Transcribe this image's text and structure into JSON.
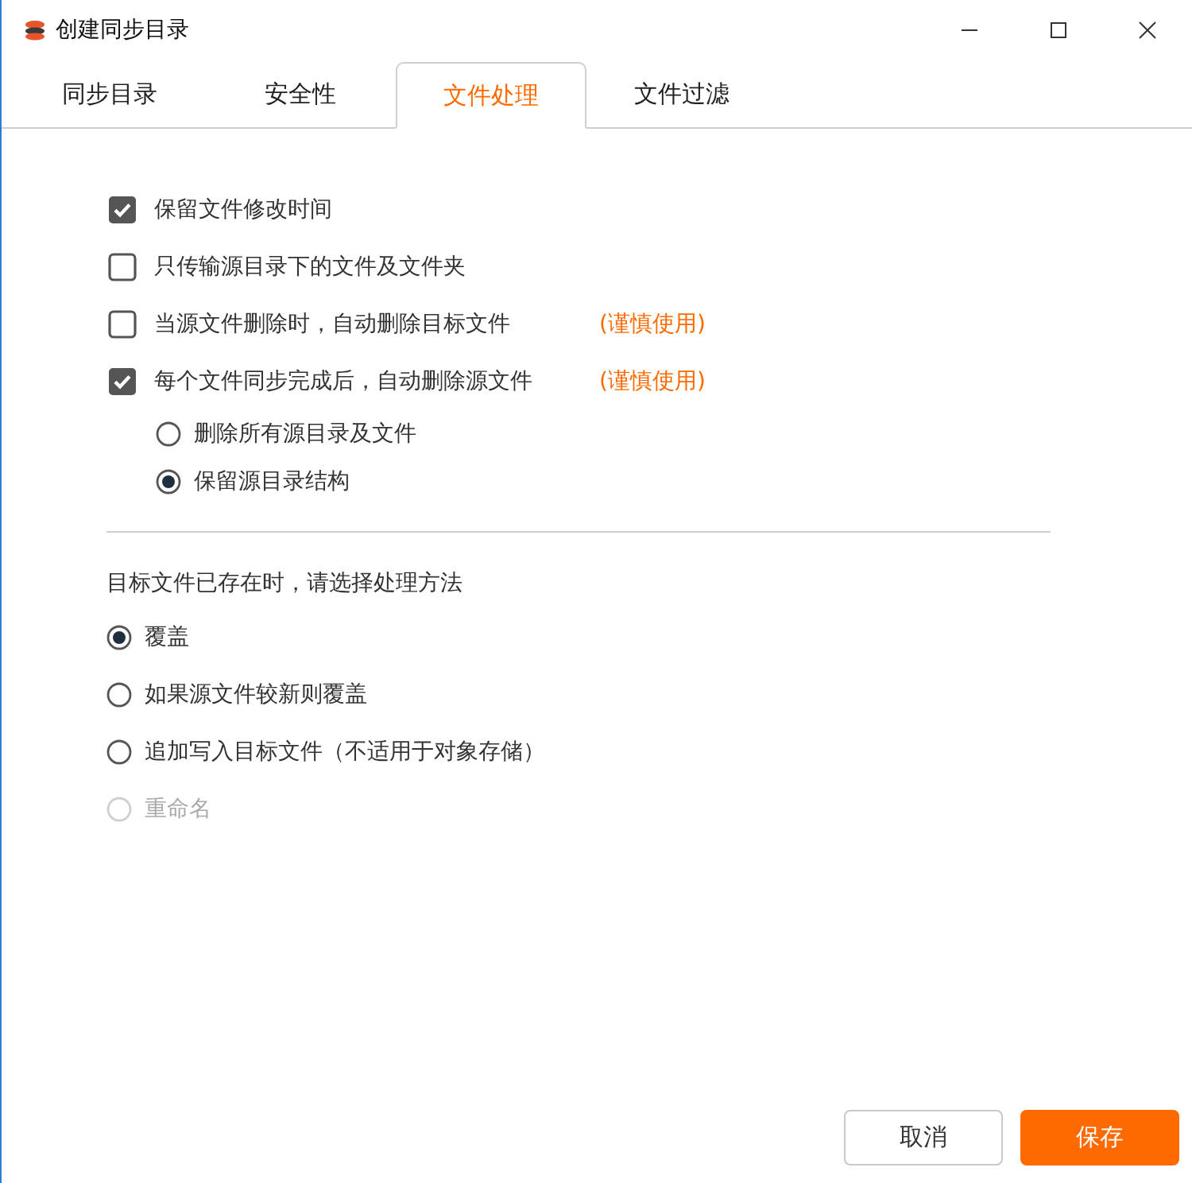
{
  "window": {
    "title": "创建同步目录"
  },
  "tabs": [
    {
      "label": "同步目录",
      "selected": false
    },
    {
      "label": "安全性",
      "selected": false
    },
    {
      "label": "文件处理",
      "selected": true
    },
    {
      "label": "文件过滤",
      "selected": false
    }
  ],
  "options": [
    {
      "label": "保留文件修改时间",
      "checked": true
    },
    {
      "label": "只传输源目录下的文件及文件夹",
      "checked": false
    },
    {
      "label": "当源文件删除时，自动删除目标文件",
      "checked": false,
      "note": "(谨慎使用)"
    },
    {
      "label": "每个文件同步完成后，自动删除源文件",
      "checked": true,
      "note": "(谨慎使用)",
      "choices": [
        {
          "label": "删除所有源目录及文件",
          "selected": false
        },
        {
          "label": "保留源目录结构",
          "selected": true
        }
      ]
    }
  ],
  "conflict": {
    "heading": "目标文件已存在时，请选择处理方法",
    "choices": [
      {
        "label": "覆盖",
        "selected": true,
        "disabled": false
      },
      {
        "label": "如果源文件较新则覆盖",
        "selected": false,
        "disabled": false
      },
      {
        "label": "追加写入目标文件（不适用于对象存储）",
        "selected": false,
        "disabled": false
      },
      {
        "label": "重命名",
        "selected": false,
        "disabled": true
      }
    ]
  },
  "buttons": [
    {
      "label": "取消",
      "kind": "secondary"
    },
    {
      "label": "保存",
      "kind": "primary"
    }
  ]
}
